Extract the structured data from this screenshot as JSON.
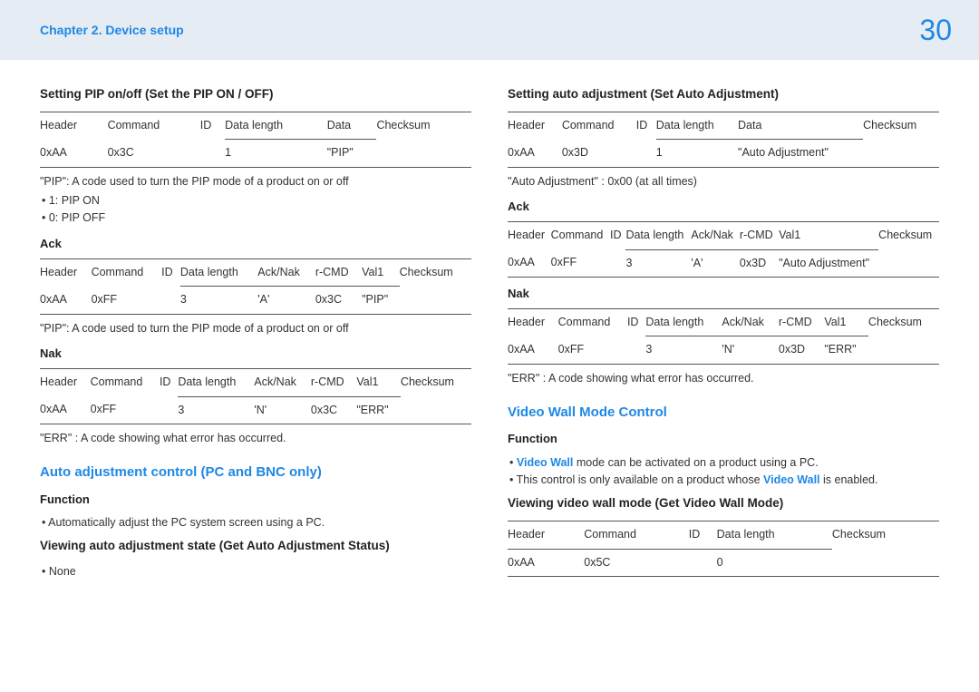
{
  "header": {
    "chapter": "Chapter 2. Device setup",
    "page": "30"
  },
  "left": {
    "pip": {
      "title": "Setting PIP on/off (Set the PIP ON / OFF)",
      "tbl": {
        "h": [
          "Header",
          "Command",
          "ID",
          "Data length",
          "Data",
          "Checksum"
        ],
        "r": [
          "0xAA",
          "0x3C",
          "",
          "1",
          "\"PIP\"",
          ""
        ]
      },
      "note1": "\"PIP\": A code used to turn the PIP mode of a product on or off",
      "li1": "1: PIP ON",
      "li2": "0: PIP OFF",
      "ack_title": "Ack",
      "ack": {
        "h": [
          "Header",
          "Command",
          "ID",
          "Data length",
          "Ack/Nak",
          "r-CMD",
          "Val1",
          "Checksum"
        ],
        "r": [
          "0xAA",
          "0xFF",
          "",
          "3",
          "'A'",
          "0x3C",
          "\"PIP\"",
          ""
        ]
      },
      "note2": "\"PIP\": A code used to turn the PIP mode of a product on or off",
      "nak_title": "Nak",
      "nak": {
        "h": [
          "Header",
          "Command",
          "ID",
          "Data length",
          "Ack/Nak",
          "r-CMD",
          "Val1",
          "Checksum"
        ],
        "r": [
          "0xAA",
          "0xFF",
          "",
          "3",
          "'N'",
          "0x3C",
          "\"ERR\"",
          ""
        ]
      },
      "note3": "\"ERR\" : A code showing what error has occurred."
    },
    "auto": {
      "title": "Auto adjustment control (PC and BNC only)",
      "func_title": "Function",
      "func_li": "Automatically adjust the PC system screen using a PC.",
      "view_title": "Viewing auto adjustment state (Get Auto Adjustment Status)",
      "view_li": "None"
    }
  },
  "right": {
    "set": {
      "title": "Setting auto adjustment (Set Auto Adjustment)",
      "tbl": {
        "h": [
          "Header",
          "Command",
          "ID",
          "Data length",
          "Data",
          "Checksum"
        ],
        "r": [
          "0xAA",
          "0x3D",
          "",
          "1",
          "\"Auto Adjustment\"",
          ""
        ]
      },
      "note1": "\"Auto Adjustment\" : 0x00 (at all times)",
      "ack_title": "Ack",
      "ack": {
        "h": [
          "Header",
          "Command",
          "ID",
          "Data length",
          "Ack/Nak",
          "r-CMD",
          "Val1",
          "Checksum"
        ],
        "r": [
          "0xAA",
          "0xFF",
          "",
          "3",
          "'A'",
          "0x3D",
          "\"Auto Adjustment\"",
          ""
        ]
      },
      "nak_title": "Nak",
      "nak": {
        "h": [
          "Header",
          "Command",
          "ID",
          "Data length",
          "Ack/Nak",
          "r-CMD",
          "Val1",
          "Checksum"
        ],
        "r": [
          "0xAA",
          "0xFF",
          "",
          "3",
          "'N'",
          "0x3D",
          "\"ERR\"",
          ""
        ]
      },
      "note3": "\"ERR\" : A code showing what error has occurred."
    },
    "vw": {
      "title": "Video Wall Mode Control",
      "func_title": "Function",
      "vw_term": "Video Wall",
      "li1_suffix": " mode can be activated on a product using a PC.",
      "li2_prefix": "This control is only available on a product whose ",
      "li2_suffix": " is enabled.",
      "view_title": "Viewing video wall mode (Get Video Wall Mode)",
      "tbl": {
        "h": [
          "Header",
          "Command",
          "ID",
          "Data length",
          "Checksum"
        ],
        "r": [
          "0xAA",
          "0x5C",
          "",
          "0",
          ""
        ]
      }
    }
  }
}
